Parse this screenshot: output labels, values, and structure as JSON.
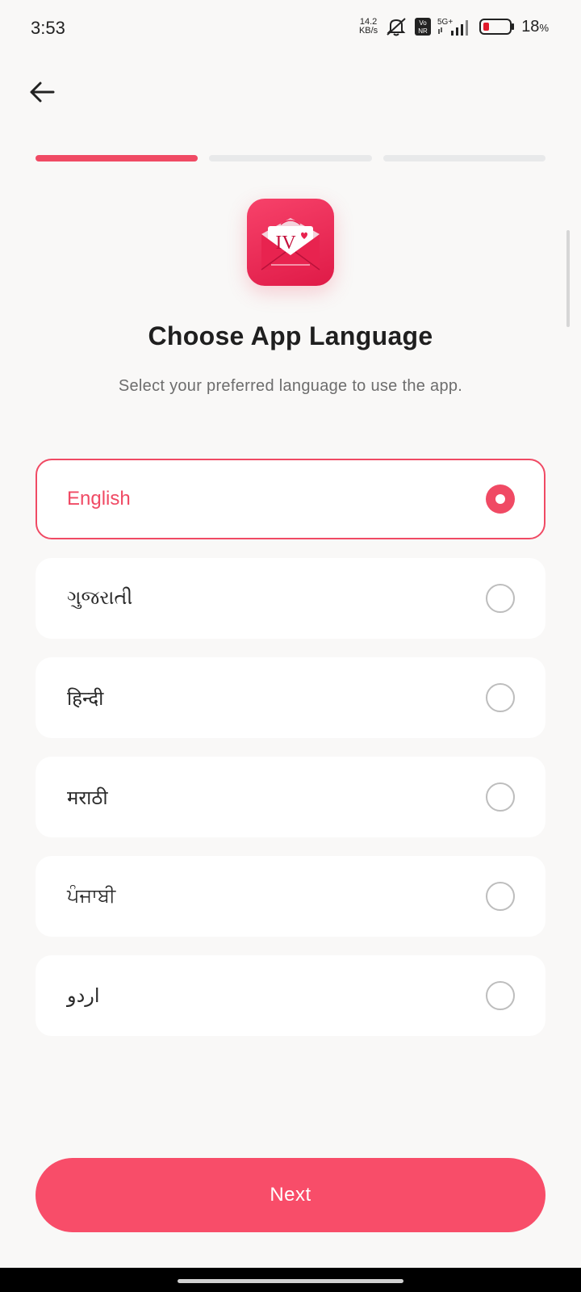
{
  "status_bar": {
    "time": "3:53",
    "net_speed_value": "14.2",
    "net_speed_unit": "KB/s",
    "volte_label_top": "Vo",
    "volte_label_bottom": "NR",
    "network_type": "5G+",
    "battery_percent": "18",
    "battery_unit": "%",
    "icons": [
      "mute-bell-icon",
      "volte-icon",
      "signal-icon",
      "battery-icon"
    ]
  },
  "header": {
    "back_icon": "arrow-left-icon"
  },
  "progress": {
    "steps_total": 3,
    "current_step": 1,
    "accent_color": "#f04a64"
  },
  "logo": {
    "text": "IV"
  },
  "main": {
    "title": "Choose App Language",
    "subtitle": "Select your preferred language to use the app."
  },
  "languages": [
    {
      "label": "English",
      "selected": true
    },
    {
      "label": "ગુજરાતી",
      "selected": false
    },
    {
      "label": "हिन्दी",
      "selected": false
    },
    {
      "label": "मराठी",
      "selected": false
    },
    {
      "label": "ਪੰਜਾਬੀ",
      "selected": false
    },
    {
      "label": "اردو",
      "selected": false
    }
  ],
  "footer": {
    "next_label": "Next",
    "button_color": "#f84d69"
  }
}
